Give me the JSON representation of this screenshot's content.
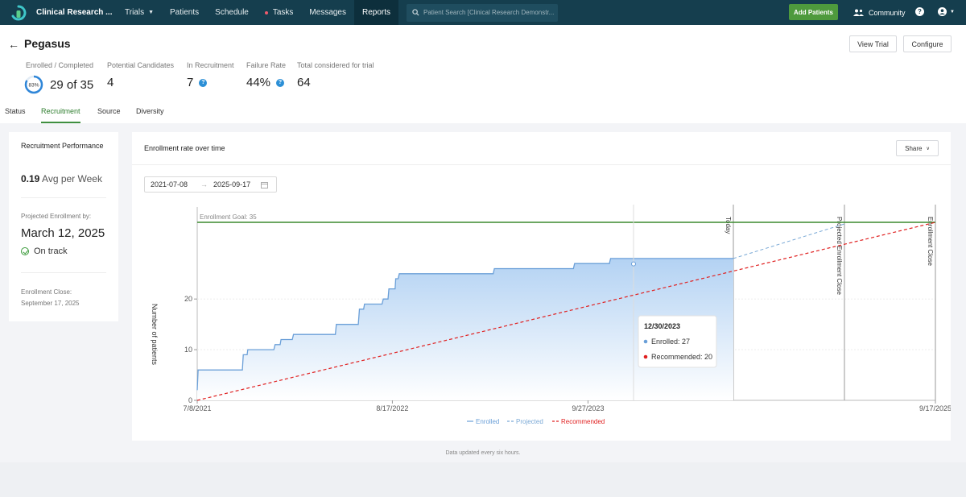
{
  "nav": {
    "brand": "Clinical Research ...",
    "items": [
      {
        "label": "Trials",
        "caret": true
      },
      {
        "label": "Patients"
      },
      {
        "label": "Schedule"
      },
      {
        "label": "Tasks",
        "dot": true
      },
      {
        "label": "Messages"
      },
      {
        "label": "Reports",
        "active": true
      }
    ],
    "search_placeholder": "Patient Search [Clinical Research Demonstr...",
    "add_patients": "Add Patients",
    "community": "Community"
  },
  "header": {
    "title": "Pegasus",
    "view_trial": "View Trial",
    "configure": "Configure",
    "stats": [
      {
        "label": "Enrolled / Completed",
        "value": "29 of 35",
        "ring": "83%",
        "ring_fraction": 0.83
      },
      {
        "label": "Potential Candidates",
        "value": "4"
      },
      {
        "label": "In Recruitment",
        "value": "7",
        "help": true
      },
      {
        "label": "Failure Rate",
        "value": "44%",
        "help": true
      },
      {
        "label": "Total considered for trial",
        "value": "64"
      }
    ],
    "tabs": [
      "Status",
      "Recruitment",
      "Source",
      "Diversity"
    ],
    "active_tab": "Recruitment"
  },
  "performance": {
    "title": "Recruitment Performance",
    "avg_value": "0.19",
    "avg_label": "Avg per Week",
    "projected_label": "Projected Enrollment by:",
    "projected_date": "March 12, 2025",
    "status": "On track",
    "close_label": "Enrollment Close:",
    "close_date": "September 17, 2025"
  },
  "chart_panel": {
    "title": "Enrollment rate over time",
    "share": "Share",
    "range_start": "2021-07-08",
    "range_end": "2025-09-17",
    "footer": "Data updated every six hours."
  },
  "chart_data": {
    "type": "line",
    "ylabel": "Number of patients",
    "y_ticks": [
      0,
      10,
      20
    ],
    "x_ticks": [
      "7/8/2021",
      "8/17/2022",
      "9/27/2023",
      "9/17/2025"
    ],
    "x_tick_days": [
      0,
      405,
      811,
      1532
    ],
    "xlim_days": [
      0,
      1532
    ],
    "ylim": [
      0,
      35
    ],
    "goal": {
      "label": "Enrollment Goal: 35",
      "value": 35
    },
    "colors": {
      "enrolled": "#6a9fd8",
      "projected": "#7aa9d6",
      "recommended": "#e02020",
      "goal": "#3b8a2f",
      "area_top": "#b3d2f3",
      "area_bottom": "#ffffff"
    },
    "series": [
      {
        "name": "Enrolled",
        "points_days": [
          [
            0,
            2
          ],
          [
            3,
            6
          ],
          [
            152,
            6
          ],
          [
            155,
            9
          ],
          [
            168,
            9
          ],
          [
            170,
            10
          ],
          [
            258,
            10
          ],
          [
            262,
            11
          ],
          [
            279,
            11
          ],
          [
            282,
            12
          ],
          [
            320,
            12
          ],
          [
            324,
            13
          ],
          [
            465,
            13
          ],
          [
            468,
            15
          ],
          [
            542,
            15
          ],
          [
            546,
            18
          ],
          [
            560,
            18
          ],
          [
            563,
            19
          ],
          [
            622,
            19
          ],
          [
            626,
            20
          ],
          [
            642,
            20
          ],
          [
            645,
            22
          ],
          [
            666,
            22
          ],
          [
            668,
            24
          ],
          [
            676,
            24
          ],
          [
            680,
            25
          ],
          [
            996,
            25
          ],
          [
            1000,
            26
          ],
          [
            1266,
            26
          ],
          [
            1270,
            27
          ],
          [
            1387,
            27
          ],
          [
            1391,
            28
          ],
          [
            2360,
            28
          ],
          [
            2364,
            29
          ],
          [
            2500,
            29
          ]
        ],
        "points": [
          [
            "7/8/2021",
            2
          ],
          [
            "7/11/2021",
            6
          ],
          [
            "12/7/2021",
            6
          ],
          [
            "12/10/2021",
            9
          ],
          [
            "12/23/2021",
            9
          ],
          [
            "12/25/2021",
            10
          ],
          [
            "3/23/2022",
            10
          ],
          [
            "3/27/2022",
            11
          ],
          [
            "4/13/2022",
            11
          ],
          [
            "4/16/2022",
            12
          ],
          [
            "5/24/2022",
            12
          ],
          [
            "5/28/2022",
            13
          ],
          [
            "10/16/2022",
            13
          ],
          [
            "10/19/2022",
            15
          ],
          [
            "1/1/2023",
            15
          ],
          [
            "1/5/2023",
            18
          ],
          [
            "1/19/2023",
            18
          ],
          [
            "1/22/2023",
            19
          ],
          [
            "3/22/2023",
            19
          ],
          [
            "3/26/2023",
            20
          ],
          [
            "4/11/2023",
            20
          ],
          [
            "4/14/2023",
            22
          ],
          [
            "5/5/2023",
            22
          ],
          [
            "5/7/2023",
            24
          ],
          [
            "5/15/2023",
            24
          ],
          [
            "5/19/2023",
            25
          ],
          [
            "3/30/2024",
            25
          ],
          [
            "4/3/2024",
            26
          ],
          [
            "12/25/2024",
            26
          ],
          [
            "12/29/2024",
            27
          ],
          [
            "4/25/2025",
            27
          ],
          [
            "4/29/2025",
            28
          ]
        ]
      },
      {
        "name": "Projected"
      },
      {
        "name": "Recommended",
        "points": [
          [
            "7/8/2021",
            0
          ],
          [
            "9/17/2025",
            35
          ]
        ]
      }
    ],
    "markers": [
      {
        "label": "Today"
      },
      {
        "label": "Projected Enrollment Close"
      },
      {
        "label": "Enrollment Close"
      }
    ],
    "tooltip": {
      "date": "12/30/2023",
      "enrolled": "Enrolled: 27",
      "recommended": "Recommended: 20"
    },
    "legend": [
      {
        "label": "Enrolled",
        "style": "solid"
      },
      {
        "label": "Projected",
        "style": "dashed"
      },
      {
        "label": "Recommended",
        "style": "dashed"
      }
    ]
  }
}
